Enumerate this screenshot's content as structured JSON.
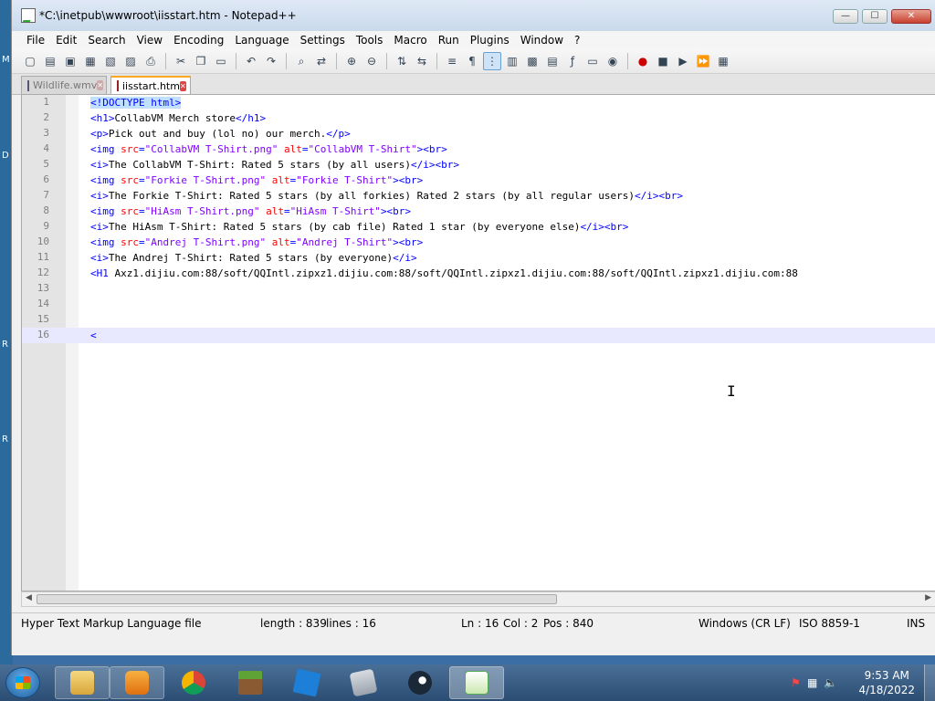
{
  "window": {
    "title": "*C:\\inetpub\\wwwroot\\iisstart.htm - Notepad++",
    "controls": {
      "minimize": "—",
      "maximize": "☐",
      "close": "✕"
    }
  },
  "menu": [
    "File",
    "Edit",
    "Search",
    "View",
    "Encoding",
    "Language",
    "Settings",
    "Tools",
    "Macro",
    "Run",
    "Plugins",
    "Window",
    "?"
  ],
  "tabs": [
    {
      "label": "Wildlife.wmv",
      "active": false
    },
    {
      "label": "iisstart.htm",
      "active": true
    }
  ],
  "editor": {
    "current_line": 16,
    "lines": [
      {
        "n": "1",
        "segments": [
          [
            "d",
            "<!DOCTYPE html>"
          ]
        ]
      },
      {
        "n": "2",
        "segments": [
          [
            "t",
            "<h1>"
          ],
          [
            "",
            "CollabVM Merch store"
          ],
          [
            "t",
            "</h1>"
          ]
        ]
      },
      {
        "n": "3",
        "segments": [
          [
            "t",
            "<p>"
          ],
          [
            "",
            "Pick out and buy (lol no) our merch."
          ],
          [
            "t",
            "</p>"
          ]
        ]
      },
      {
        "n": "4",
        "segments": [
          [
            "t",
            "<img "
          ],
          [
            "a",
            "src"
          ],
          [
            "t",
            "="
          ],
          [
            "v",
            "\"CollabVM T-Shirt.png\""
          ],
          [
            "t",
            " "
          ],
          [
            "a",
            "alt"
          ],
          [
            "t",
            "="
          ],
          [
            "v",
            "\"CollabVM T-Shirt\""
          ],
          [
            "t",
            "><br>"
          ]
        ]
      },
      {
        "n": "5",
        "segments": [
          [
            "t",
            "<i>"
          ],
          [
            "",
            "The CollabVM T-Shirt: Rated 5 stars (by all users)"
          ],
          [
            "t",
            "</i><br>"
          ]
        ]
      },
      {
        "n": "6",
        "segments": [
          [
            "t",
            "<img "
          ],
          [
            "a",
            "src"
          ],
          [
            "t",
            "="
          ],
          [
            "v",
            "\"Forkie T-Shirt.png\""
          ],
          [
            "t",
            " "
          ],
          [
            "a",
            "alt"
          ],
          [
            "t",
            "="
          ],
          [
            "v",
            "\"Forkie T-Shirt\""
          ],
          [
            "t",
            "><br>"
          ]
        ]
      },
      {
        "n": "7",
        "segments": [
          [
            "t",
            "<i>"
          ],
          [
            "",
            "The Forkie T-Shirt: Rated 5 stars (by all forkies) Rated 2 stars (by all regular users)"
          ],
          [
            "t",
            "</i><br>"
          ]
        ]
      },
      {
        "n": "8",
        "segments": [
          [
            "t",
            "<img "
          ],
          [
            "a",
            "src"
          ],
          [
            "t",
            "="
          ],
          [
            "v",
            "\"HiAsm T-Shirt.png\""
          ],
          [
            "t",
            " "
          ],
          [
            "a",
            "alt"
          ],
          [
            "t",
            "="
          ],
          [
            "v",
            "\"HiAsm T-Shirt\""
          ],
          [
            "t",
            "><br>"
          ]
        ]
      },
      {
        "n": "9",
        "segments": [
          [
            "t",
            "<i>"
          ],
          [
            "",
            "The HiAsm T-Shirt: Rated 5 stars (by cab file) Rated 1 star (by everyone else)"
          ],
          [
            "t",
            "</i><br>"
          ]
        ]
      },
      {
        "n": "10",
        "segments": [
          [
            "t",
            "<img "
          ],
          [
            "a",
            "src"
          ],
          [
            "t",
            "="
          ],
          [
            "v",
            "\"Andrej T-Shirt.png\""
          ],
          [
            "t",
            " "
          ],
          [
            "a",
            "alt"
          ],
          [
            "t",
            "="
          ],
          [
            "v",
            "\"Andrej T-Shirt\""
          ],
          [
            "t",
            "><br>"
          ]
        ]
      },
      {
        "n": "11",
        "segments": [
          [
            "t",
            "<i>"
          ],
          [
            "",
            "The Andrej T-Shirt: Rated 5 stars (by everyone)"
          ],
          [
            "t",
            "</i>"
          ]
        ]
      },
      {
        "n": "12",
        "segments": [
          [
            "t",
            "<H1 "
          ],
          [
            "",
            "Axz1.dijiu.com:88/soft/QQIntl.zipxz1.dijiu.com:88/soft/QQIntl.zipxz1.dijiu.com:88/soft/QQIntl.zipxz1.dijiu.com:88"
          ]
        ]
      },
      {
        "n": "13",
        "segments": []
      },
      {
        "n": "14",
        "segments": []
      },
      {
        "n": "15",
        "segments": []
      },
      {
        "n": "16",
        "segments": [
          [
            "t",
            "<"
          ]
        ]
      }
    ]
  },
  "status": {
    "file_type": "Hyper Text Markup Language file",
    "length": "length : 839",
    "lines": "lines : 16",
    "ln": "Ln : 16",
    "col": "Col : 2",
    "pos": "Pos : 840",
    "eol": "Windows (CR LF)",
    "encoding": "ISO 8859-1",
    "mode": "INS"
  },
  "taskbar": {
    "time": "9:53 AM",
    "date": "4/18/2022"
  },
  "desktop_letters": [
    "M",
    "D",
    "R",
    "R"
  ]
}
